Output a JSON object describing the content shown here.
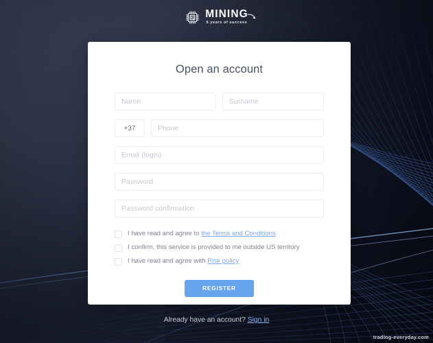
{
  "brand": {
    "chip_icon": "chip-iq-icon",
    "chip_text": "IQ",
    "title": "MINING",
    "tagline": "6 years of success",
    "swoosh_icon": "swoosh-icon"
  },
  "card": {
    "title": "Open an account",
    "fields": {
      "name": {
        "placeholder": "Name",
        "value": ""
      },
      "surname": {
        "placeholder": "Surname",
        "value": ""
      },
      "country_code": {
        "placeholder": "",
        "value": "+37"
      },
      "phone": {
        "placeholder": "Phone",
        "value": ""
      },
      "email": {
        "placeholder": "Email (login)",
        "value": ""
      },
      "password": {
        "placeholder": "Password",
        "value": ""
      },
      "password_confirmation": {
        "placeholder": "Password confirmation",
        "value": ""
      }
    },
    "checkboxes": [
      {
        "checked": false,
        "text_before": "I have read and agree to ",
        "link": "the Terms and Conditions",
        "text_after": ""
      },
      {
        "checked": false,
        "text_before": "I confirm, this service is provided to me outside US territory",
        "link": "",
        "text_after": ""
      },
      {
        "checked": false,
        "text_before": "I have read and agree with ",
        "link": "Risk policy",
        "text_after": ""
      }
    ],
    "submit_label": "REGISTER"
  },
  "footer": {
    "text": "Already have an account? ",
    "link": "Sign in"
  },
  "watermark": "trading-everyday.com",
  "colors": {
    "accent": "#67a4f0",
    "link": "#7ea6e8",
    "background": "#2e3447",
    "card": "#ffffff",
    "title_text": "#4a5160",
    "placeholder": "#c3c7d1"
  }
}
